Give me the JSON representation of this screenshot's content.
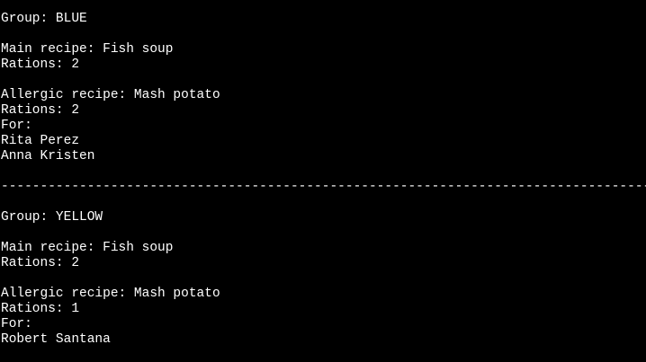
{
  "colors": {
    "background": "#000000",
    "text": "#ffffff"
  },
  "blocks": [
    {
      "group_line": "Group: BLUE",
      "main_line": "Main recipe: Fish soup",
      "main_rations_line": "Rations: 2",
      "allergic_line": "Allergic recipe: Mash potato",
      "allergic_rations_line": "Rations: 2",
      "for_line": "For:",
      "people": [
        "Rita Perez",
        "Anna Kristen"
      ]
    },
    {
      "group_line": "Group: YELLOW",
      "main_line": "Main recipe: Fish soup",
      "main_rations_line": "Rations: 2",
      "allergic_line": "Allergic recipe: Mash potato",
      "allergic_rations_line": "Rations: 1",
      "for_line": "For:",
      "people": [
        "Robert Santana"
      ]
    }
  ],
  "separator": "------------------------------------------------------------------------------------------------------------------------"
}
